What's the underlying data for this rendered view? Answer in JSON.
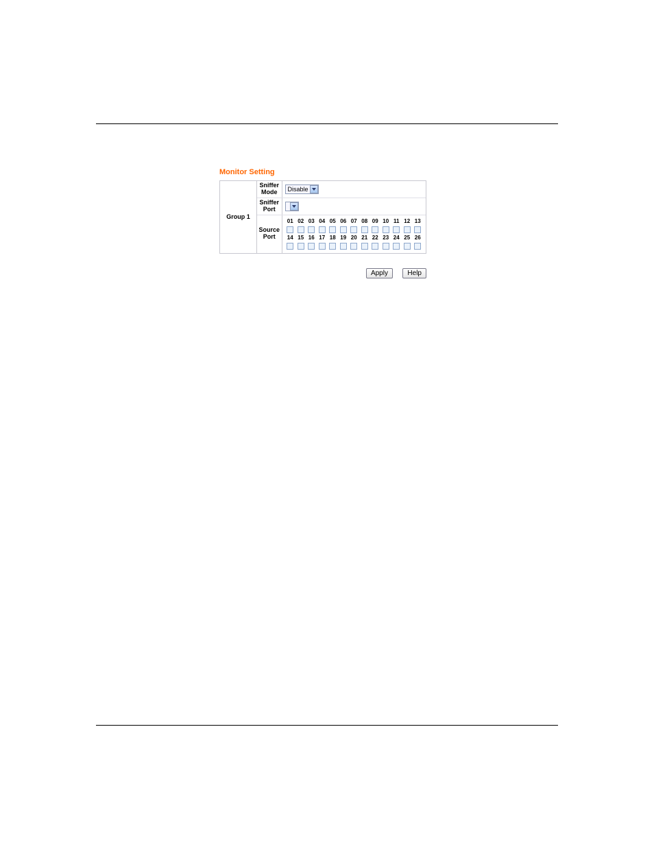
{
  "title": "Monitor Setting",
  "group_label": "Group 1",
  "rows": {
    "sniffer_mode": {
      "label1": "Sniffer",
      "label2": "Mode",
      "value": "Disable"
    },
    "sniffer_port": {
      "label1": "Sniffer",
      "label2": "Port",
      "value": ""
    },
    "source_port": {
      "label1": "Source",
      "label2": "Port"
    }
  },
  "ports_row1": [
    "01",
    "02",
    "03",
    "04",
    "05",
    "06",
    "07",
    "08",
    "09",
    "10",
    "11",
    "12",
    "13"
  ],
  "ports_row2": [
    "14",
    "15",
    "16",
    "17",
    "18",
    "19",
    "20",
    "21",
    "22",
    "23",
    "24",
    "25",
    "26"
  ],
  "buttons": {
    "apply": "Apply",
    "help": "Help"
  }
}
